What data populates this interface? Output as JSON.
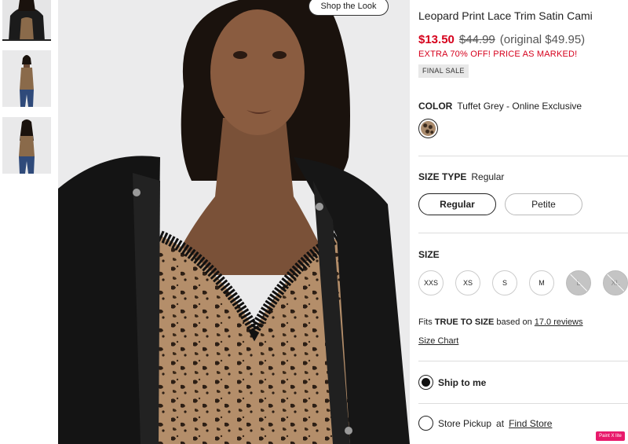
{
  "shop_the_look": "Shop the Look",
  "product": {
    "title": "Leopard Print Lace Trim Satin Cami",
    "price_sale": "$13.50",
    "price_was": "$44.99",
    "price_original": "(original $49.95)",
    "promo": "EXTRA 70% OFF! PRICE AS MARKED!",
    "final_sale": "FINAL SALE"
  },
  "color": {
    "label": "COLOR",
    "value": "Tuffet Grey  -  Online Exclusive",
    "swatch_icon": "leopard-swatch"
  },
  "size_type": {
    "label": "SIZE TYPE",
    "value": "Regular",
    "options": [
      "Regular",
      "Petite"
    ],
    "selected": "Regular"
  },
  "size": {
    "label": "SIZE",
    "options": [
      {
        "label": "XXS",
        "available": true
      },
      {
        "label": "XS",
        "available": true
      },
      {
        "label": "S",
        "available": true
      },
      {
        "label": "M",
        "available": true
      },
      {
        "label": "L",
        "available": false
      },
      {
        "label": "XL",
        "available": false
      }
    ]
  },
  "fit": {
    "prefix": "Fits ",
    "emphasis": "TRUE TO SIZE",
    "middle": " based on ",
    "reviews_link": "17.0 reviews",
    "size_chart": "Size Chart"
  },
  "fulfillment": {
    "ship_label": "Ship to me",
    "pickup_label": "Store Pickup",
    "pickup_at": "at",
    "find_store": "Find Store"
  },
  "badge": "Paint X lite",
  "colors": {
    "sale": "#d6001c",
    "badge": "#e8196b"
  }
}
